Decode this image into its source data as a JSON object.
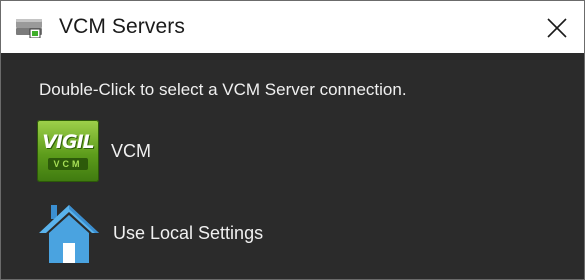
{
  "window": {
    "title": "VCM Servers",
    "app_icon": "server-drive-icon",
    "close_glyph": "✕"
  },
  "instruction": "Double-Click to select a VCM Server connection.",
  "servers": [
    {
      "label": "VCM",
      "icon": "vigil-vcm-logo-icon",
      "logo_text_top": "VIGIL",
      "logo_text_bottom": "VCM"
    },
    {
      "label": "Use Local Settings",
      "icon": "house-icon"
    }
  ],
  "colors": {
    "titlebar_bg": "#ffffff",
    "content_bg": "#2b2b2b",
    "text": "#f0f0f0",
    "vigil_green": "#6aab24",
    "house_blue": "#4aa3e0"
  }
}
